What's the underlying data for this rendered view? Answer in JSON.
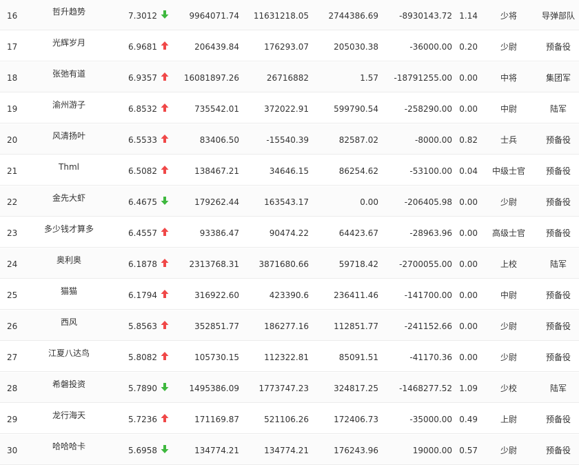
{
  "colors": {
    "up": "#f04848",
    "down": "#3eb83e"
  },
  "rows": [
    {
      "rank": "16",
      "name": "哲升趋势",
      "score": "7.3012",
      "trend": "down",
      "v1": "9964071.74",
      "v2": "11631218.05",
      "v3": "2744386.69",
      "v4": "-8930143.72",
      "v5": "1.14",
      "title": "少将",
      "unit": "导弹部队"
    },
    {
      "rank": "17",
      "name": "光辉岁月",
      "score": "6.9681",
      "trend": "up",
      "v1": "206439.84",
      "v2": "176293.07",
      "v3": "205030.38",
      "v4": "-36000.00",
      "v5": "0.20",
      "title": "少尉",
      "unit": "预备役"
    },
    {
      "rank": "18",
      "name": "张弛有道",
      "score": "6.9357",
      "trend": "up",
      "v1": "16081897.26",
      "v2": "26716882",
      "v3": "1.57",
      "v4": "-18791255.00",
      "v5": "0.00",
      "title": "中将",
      "unit": "集团军"
    },
    {
      "rank": "19",
      "name": "渝州游子",
      "score": "6.8532",
      "trend": "up",
      "v1": "735542.01",
      "v2": "372022.91",
      "v3": "599790.54",
      "v4": "-258290.00",
      "v5": "0.00",
      "title": "中尉",
      "unit": "陆军"
    },
    {
      "rank": "20",
      "name": "风清扬叶",
      "score": "6.5533",
      "trend": "up",
      "v1": "83406.50",
      "v2": "-15540.39",
      "v3": "82587.02",
      "v4": "-8000.00",
      "v5": "0.82",
      "title": "士兵",
      "unit": "预备役"
    },
    {
      "rank": "21",
      "name": "Thml",
      "score": "6.5082",
      "trend": "up",
      "v1": "138467.21",
      "v2": "34646.15",
      "v3": "86254.62",
      "v4": "-53100.00",
      "v5": "0.04",
      "title": "中级士官",
      "unit": "预备役"
    },
    {
      "rank": "22",
      "name": "金先大虾",
      "score": "6.4675",
      "trend": "down",
      "v1": "179262.44",
      "v2": "163543.17",
      "v3": "0.00",
      "v4": "-206405.98",
      "v5": "0.00",
      "title": "少尉",
      "unit": "预备役"
    },
    {
      "rank": "23",
      "name": "多少钱才算多",
      "score": "6.4557",
      "trend": "up",
      "v1": "93386.47",
      "v2": "90474.22",
      "v3": "64423.67",
      "v4": "-28963.96",
      "v5": "0.00",
      "title": "高级士官",
      "unit": "预备役"
    },
    {
      "rank": "24",
      "name": "奥利奥",
      "score": "6.1878",
      "trend": "up",
      "v1": "2313768.31",
      "v2": "3871680.66",
      "v3": "59718.42",
      "v4": "-2700055.00",
      "v5": "0.00",
      "title": "上校",
      "unit": "陆军"
    },
    {
      "rank": "25",
      "name": "猫猫",
      "score": "6.1794",
      "trend": "up",
      "v1": "316922.60",
      "v2": "423390.6",
      "v3": "236411.46",
      "v4": "-141700.00",
      "v5": "0.00",
      "title": "中尉",
      "unit": "预备役"
    },
    {
      "rank": "26",
      "name": "西风",
      "score": "5.8563",
      "trend": "up",
      "v1": "352851.77",
      "v2": "186277.16",
      "v3": "112851.77",
      "v4": "-241152.66",
      "v5": "0.00",
      "title": "少尉",
      "unit": "预备役"
    },
    {
      "rank": "27",
      "name": "江夏八达鸟",
      "score": "5.8082",
      "trend": "up",
      "v1": "105730.15",
      "v2": "112322.81",
      "v3": "85091.51",
      "v4": "-41170.36",
      "v5": "0.00",
      "title": "少尉",
      "unit": "预备役"
    },
    {
      "rank": "28",
      "name": "希磐投资",
      "score": "5.7890",
      "trend": "down",
      "v1": "1495386.09",
      "v2": "1773747.23",
      "v3": "324817.25",
      "v4": "-1468277.52",
      "v5": "1.09",
      "title": "少校",
      "unit": "陆军"
    },
    {
      "rank": "29",
      "name": "龙行海天",
      "score": "5.7236",
      "trend": "up",
      "v1": "171169.87",
      "v2": "521106.26",
      "v3": "172406.73",
      "v4": "-35000.00",
      "v5": "0.49",
      "title": "上尉",
      "unit": "预备役"
    },
    {
      "rank": "30",
      "name": "哈哈哈卡",
      "score": "5.6958",
      "trend": "down",
      "v1": "134774.21",
      "v2": "134774.21",
      "v3": "176243.96",
      "v4": "19000.00",
      "v5": "0.57",
      "title": "少尉",
      "unit": "预备役"
    }
  ]
}
